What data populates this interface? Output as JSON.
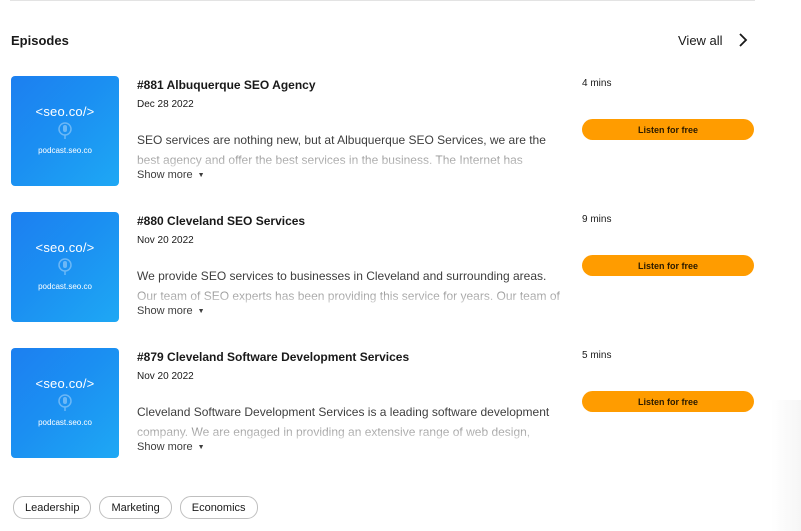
{
  "section": {
    "title": "Episodes",
    "view_all": "View all"
  },
  "episodes": [
    {
      "title": "#881 Albuquerque SEO Agency",
      "date": "Dec 28 2022",
      "description": "SEO services are nothing new, but at Albuquerque SEO Services, we are the best agency and offer the best services in the business. The Internet has changed the way we do business, and the ways in which companies market themselves online.",
      "show_more": "Show more",
      "duration": "4 mins",
      "listen": "Listen for free",
      "cover": {
        "logo": "<seo.co/>",
        "site": "podcast.seo.co"
      }
    },
    {
      "title": "#880 Cleveland SEO Services",
      "date": "Nov 20 2022",
      "description": "We provide SEO services to businesses in Cleveland and surrounding areas. Our team of SEO experts has been providing this service for years. Our team of specialists works with you to increase visibility online.",
      "show_more": "Show more",
      "duration": "9 mins",
      "listen": "Listen for free",
      "cover": {
        "logo": "<seo.co/>",
        "site": "podcast.seo.co"
      }
    },
    {
      "title": "#879 Cleveland Software Development Services",
      "date": "Nov 20 2022",
      "description": "Cleveland Software Development Services is a leading software development company. We are engaged in providing an extensive range of web design, mobile and software development services to clients.",
      "show_more": "Show more",
      "duration": "5 mins",
      "listen": "Listen for free",
      "cover": {
        "logo": "<seo.co/>",
        "site": "podcast.seo.co"
      }
    }
  ],
  "tags": [
    "Leadership",
    "Marketing",
    "Economics"
  ],
  "colors": {
    "accent": "#ff9c00",
    "cover_blue": "#1b8ff2"
  },
  "icons": {
    "view_all": "chevron-right-icon",
    "show_more": "caret-down-icon",
    "cover": "microphone-icon"
  }
}
